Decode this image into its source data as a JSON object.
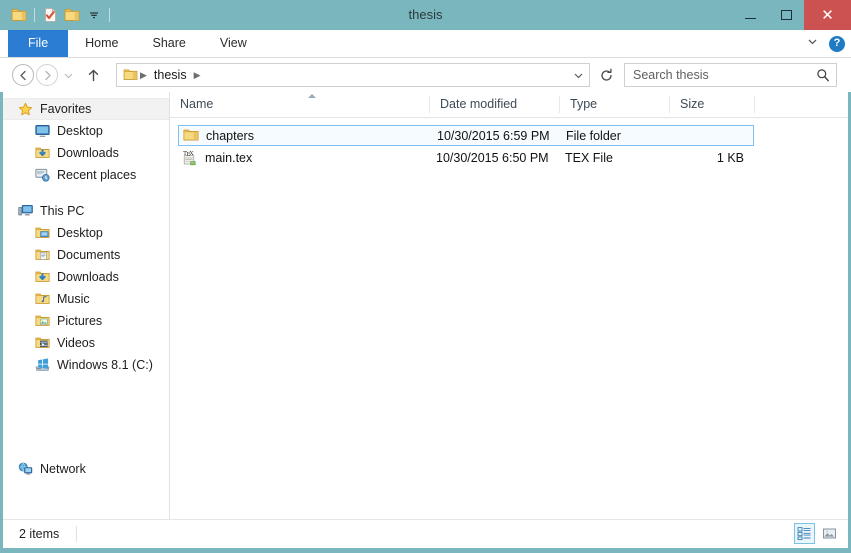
{
  "window": {
    "title": "thesis",
    "quick_access": [
      {
        "name": "folder-icon",
        "label": "Folder"
      },
      {
        "name": "properties-icon",
        "label": "Properties"
      },
      {
        "name": "new-folder-icon",
        "label": "New folder"
      },
      {
        "name": "customize-chevron-icon",
        "label": "Customize Quick Access Toolbar"
      }
    ],
    "controls": {
      "minimize": "Minimize",
      "maximize": "Maximize",
      "close": "✕"
    }
  },
  "ribbon": {
    "tabs": [
      {
        "label": "File",
        "active": true
      },
      {
        "label": "Home",
        "active": false
      },
      {
        "label": "Share",
        "active": false
      },
      {
        "label": "View",
        "active": false
      }
    ],
    "expand_label": "Expand the Ribbon",
    "help_label": "?"
  },
  "addressbar": {
    "back_label": "Back",
    "forward_label": "Forward",
    "recent_label": "Recent locations",
    "up_label": "Up",
    "crumbs": [
      "thesis"
    ],
    "dropdown_label": "Previous locations",
    "refresh_label": "Refresh",
    "colors": {
      "accent": "#2b7cd3",
      "titlebar": "#7ab6bd",
      "close": "#cc5252"
    }
  },
  "search": {
    "placeholder": "Search thesis",
    "value": "",
    "icon": "search-icon"
  },
  "navpane": {
    "groups": [
      {
        "label": "Favorites",
        "icon": "star-icon",
        "selected": true,
        "items": [
          {
            "label": "Desktop",
            "icon": "desktop-icon"
          },
          {
            "label": "Downloads",
            "icon": "downloads-icon"
          },
          {
            "label": "Recent places",
            "icon": "recent-places-icon"
          }
        ]
      },
      {
        "label": "This PC",
        "icon": "computer-icon",
        "selected": false,
        "items": [
          {
            "label": "Desktop",
            "icon": "desktop-folder-icon"
          },
          {
            "label": "Documents",
            "icon": "documents-icon"
          },
          {
            "label": "Downloads",
            "icon": "downloads-icon"
          },
          {
            "label": "Music",
            "icon": "music-icon"
          },
          {
            "label": "Pictures",
            "icon": "pictures-icon"
          },
          {
            "label": "Videos",
            "icon": "videos-icon"
          },
          {
            "label": "Windows 8.1 (C:)",
            "icon": "drive-icon"
          }
        ]
      },
      {
        "label": "Network",
        "icon": "network-icon",
        "selected": false,
        "items": []
      }
    ]
  },
  "filelist": {
    "columns": [
      {
        "label": "Name",
        "sorted": "asc"
      },
      {
        "label": "Date modified",
        "sorted": ""
      },
      {
        "label": "Type",
        "sorted": ""
      },
      {
        "label": "Size",
        "sorted": ""
      }
    ],
    "rows": [
      {
        "name": "chapters",
        "date": "10/30/2015 6:59 PM",
        "type": "File folder",
        "size": "",
        "icon": "folder-icon",
        "selected": true
      },
      {
        "name": "main.tex",
        "date": "10/30/2015 6:50 PM",
        "type": "TEX File",
        "size": "1 KB",
        "icon": "tex-file-icon",
        "selected": false
      }
    ]
  },
  "statusbar": {
    "item_count": "2 items",
    "views": [
      {
        "name": "details-view-button",
        "label": "Details view",
        "active": true
      },
      {
        "name": "large-icons-view-button",
        "label": "Large icons view",
        "active": false
      }
    ]
  }
}
